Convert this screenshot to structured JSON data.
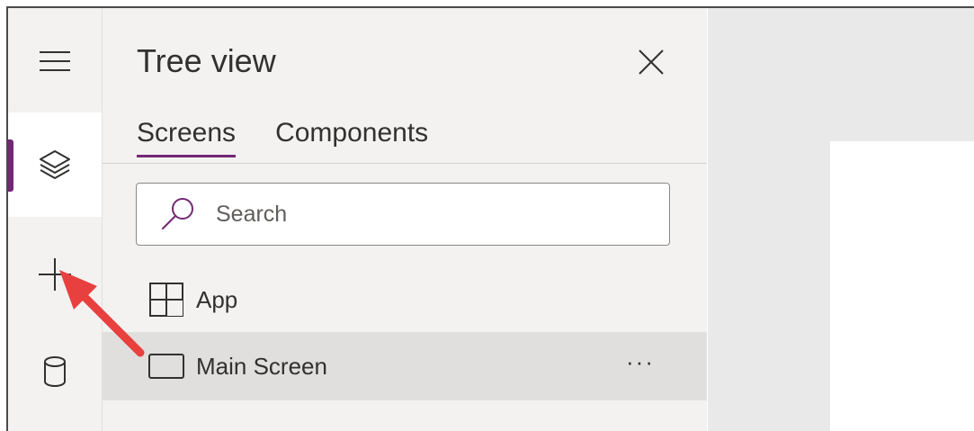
{
  "tree_panel": {
    "title": "Tree view",
    "tabs": [
      {
        "label": "Screens",
        "active": true
      },
      {
        "label": "Components",
        "active": false
      }
    ],
    "search": {
      "placeholder": "Search",
      "value": ""
    },
    "items": [
      {
        "label": "App",
        "icon": "app-grid-icon"
      },
      {
        "label": "Main Screen",
        "icon": "screen-icon",
        "selected": true,
        "more": "···"
      }
    ]
  },
  "left_rail": {
    "items": [
      {
        "name": "hamburger-menu",
        "icon": "hamburger-icon"
      },
      {
        "name": "tree-view",
        "icon": "layers-icon",
        "active": true
      },
      {
        "name": "insert",
        "icon": "plus-icon"
      },
      {
        "name": "data",
        "icon": "database-icon"
      }
    ]
  },
  "colors": {
    "accent": "#742774",
    "panel_bg": "#f3f2f1",
    "selected_row": "#e1dfdd",
    "annotation_arrow": "#e8403f"
  }
}
